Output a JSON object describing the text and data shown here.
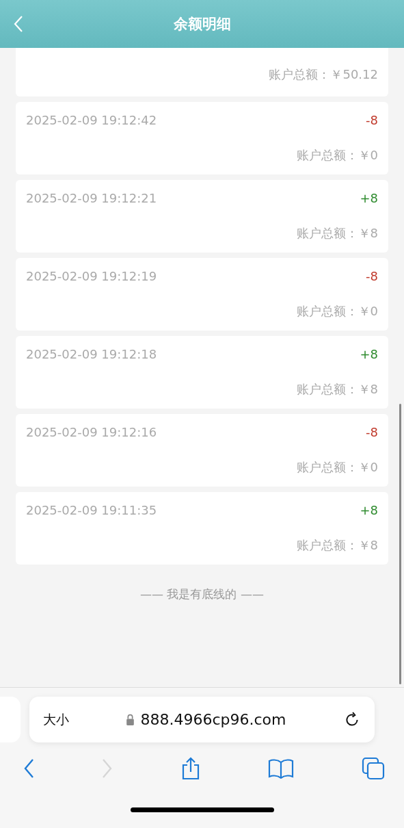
{
  "header": {
    "title": "余额明细"
  },
  "records": [
    {
      "total": "账户总额：￥50.12"
    },
    {
      "time": "2025-02-09 19:12:42",
      "amount": "-8",
      "color": "#c0392b",
      "total": "账户总额：￥0"
    },
    {
      "time": "2025-02-09 19:12:21",
      "amount": "+8",
      "color": "#2e8b2e",
      "total": "账户总额：￥8"
    },
    {
      "time": "2025-02-09 19:12:19",
      "amount": "-8",
      "color": "#c0392b",
      "total": "账户总额：￥0"
    },
    {
      "time": "2025-02-09 19:12:18",
      "amount": "+8",
      "color": "#2e8b2e",
      "total": "账户总额：￥8"
    },
    {
      "time": "2025-02-09 19:12:16",
      "amount": "-8",
      "color": "#c0392b",
      "total": "账户总额：￥0"
    },
    {
      "time": "2025-02-09 19:11:35",
      "amount": "+8",
      "color": "#2e8b2e",
      "total": "账户总额：￥8"
    }
  ],
  "footer": "—— 我是有底线的 ——",
  "browser": {
    "text_size": "大小",
    "url": "888.4966cp96.com",
    "back_disabled": false,
    "forward_disabled": true
  }
}
